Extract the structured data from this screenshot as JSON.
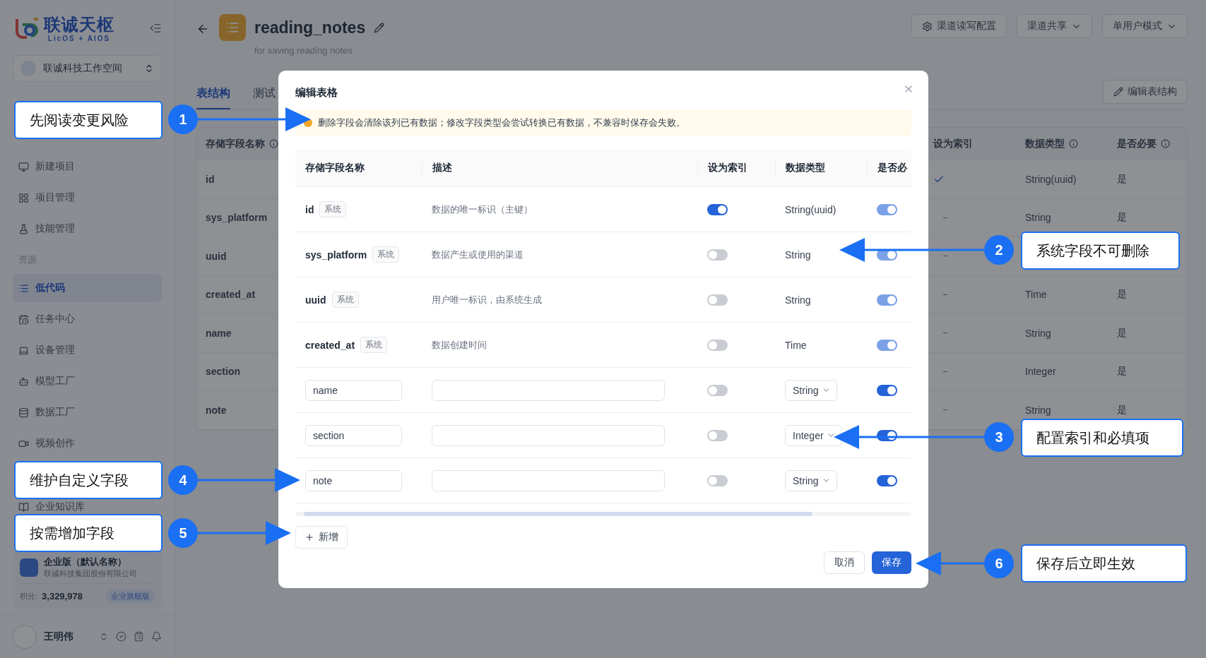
{
  "sidebar": {
    "logo": {
      "title": "联诚天枢",
      "subtitle": "LicOS + AIOS"
    },
    "workspace": "联诚科技工作空间",
    "groups": [
      {
        "items": [
          {
            "label": "新建项目",
            "selected": false
          },
          {
            "label": "项目管理",
            "selected": false
          },
          {
            "label": "技能管理",
            "selected": false
          }
        ]
      },
      {
        "label": "资源",
        "items": [
          {
            "label": "低代码",
            "selected": true
          },
          {
            "label": "任务中心",
            "selected": false
          },
          {
            "label": "设备管理",
            "selected": false
          },
          {
            "label": "模型工厂",
            "selected": false
          },
          {
            "label": "数据工厂",
            "selected": false
          },
          {
            "label": "视频创作",
            "selected": false
          }
        ]
      }
    ],
    "bottom_items": [
      {
        "label": "企业知识库",
        "selected": false
      }
    ],
    "org": {
      "name": "企业版（默认名称）",
      "company": "联诚科技集团股份有限公司",
      "points_label": "积分:",
      "points": "3,329,978",
      "plan": "企业旗舰版"
    },
    "user": {
      "name": "王明伟"
    }
  },
  "page": {
    "title": "reading_notes",
    "subtitle": "for saving reading notes",
    "actions": [
      {
        "label": "渠道读写配置",
        "kind": "settings"
      },
      {
        "label": "渠道共享",
        "kind": "dropdown"
      },
      {
        "label": "单用户模式",
        "kind": "dropdown"
      }
    ],
    "tabs": [
      {
        "label": "表结构",
        "selected": true
      },
      {
        "label": "测试",
        "selected": false
      }
    ],
    "edit_button": "编辑表结构",
    "table": {
      "columns": [
        "存储字段名称",
        "设为索引",
        "数据类型",
        "是否必要"
      ],
      "rows": [
        {
          "name": "id",
          "indexed": true,
          "type": "String(uuid)",
          "required": "是"
        },
        {
          "name": "sys_platform",
          "indexed": false,
          "type": "String",
          "required": "是"
        },
        {
          "name": "uuid",
          "indexed": false
        },
        {
          "name": "created_at",
          "indexed": false,
          "type": "Time",
          "required": "是"
        },
        {
          "name": "name",
          "indexed": false,
          "type": "String",
          "required": "是"
        },
        {
          "name": "section",
          "indexed": false,
          "type": "Integer",
          "required": "是"
        },
        {
          "name": "note",
          "indexed": false,
          "type": "String",
          "required": "是"
        }
      ]
    }
  },
  "modal": {
    "title": "编辑表格",
    "warning": "删除字段会清除该列已有数据；修改字段类型会尝试转换已有数据，不兼容时保存会失败。",
    "columns": [
      "存储字段名称",
      "描述",
      "设为索引",
      "数据类型",
      "是否必"
    ],
    "rows": [
      {
        "kind": "system",
        "name": "id",
        "badge": "系统",
        "description": "数据的唯一标识（主键）",
        "indexed": true,
        "type": "String(uuid)",
        "required": true
      },
      {
        "kind": "system",
        "name": "sys_platform",
        "badge": "系统",
        "description": "数据产生或使用的渠道",
        "indexed": false,
        "type": "String",
        "required": true
      },
      {
        "kind": "system",
        "name": "uuid",
        "badge": "系统",
        "description": "用户唯一标识，由系统生成",
        "indexed": false,
        "type": "String",
        "required": true
      },
      {
        "kind": "system",
        "name": "created_at",
        "badge": "系统",
        "description": "数据创建时间",
        "indexed": false,
        "type": "Time",
        "required": true
      },
      {
        "kind": "custom",
        "name": "name",
        "indexed": false,
        "type": "String",
        "required": true
      },
      {
        "kind": "custom",
        "name": "section",
        "indexed": false,
        "type": "Integer",
        "required": true
      },
      {
        "kind": "custom",
        "name": "note",
        "indexed": false,
        "type": "String",
        "required": true
      }
    ],
    "add_button": "新增",
    "cancel_button": "取消",
    "save_button": "保存"
  },
  "annotations": [
    {
      "number": "1",
      "text": "先阅读变更风险"
    },
    {
      "number": "2",
      "text": "系统字段不可删除"
    },
    {
      "number": "3",
      "text": "配置索引和必填项"
    },
    {
      "number": "4",
      "text": "维护自定义字段"
    },
    {
      "number": "5",
      "text": "按需增加字段"
    },
    {
      "number": "6",
      "text": "保存后立即生效"
    }
  ]
}
